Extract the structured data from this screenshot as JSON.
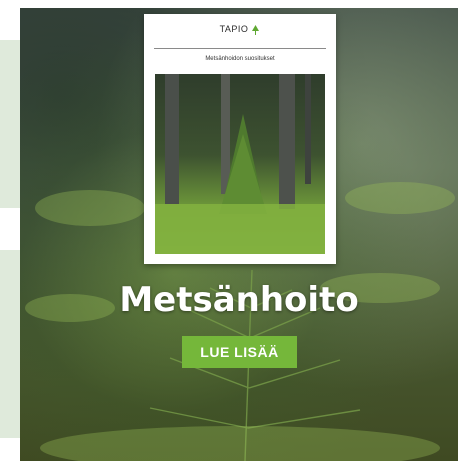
{
  "banner": {
    "booklet": {
      "brand": "TAPIO",
      "subtitle": "Metsänhoidon suositukset"
    },
    "headline": "Metsänhoito",
    "cta_label": "LUE LISÄÄ",
    "colors": {
      "accent": "#75b73a",
      "side_panel": "#dfeadb"
    },
    "icons": [
      "leaf-icon"
    ]
  }
}
